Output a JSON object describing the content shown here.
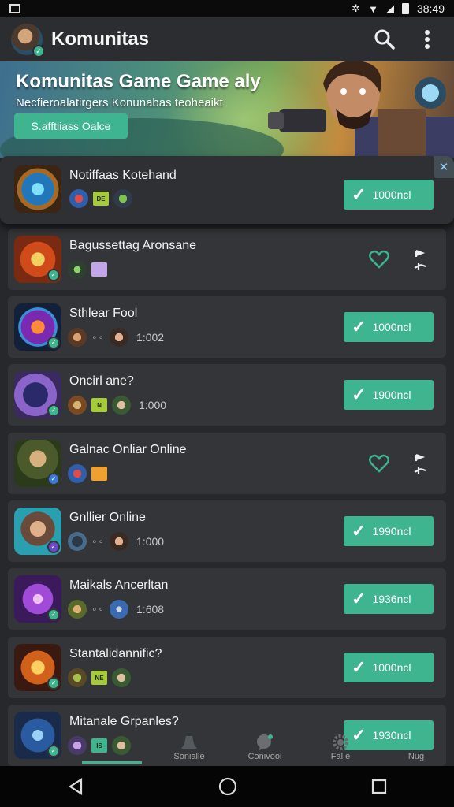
{
  "status_bar": {
    "time": "38:49"
  },
  "app_bar": {
    "title": "Komunitas"
  },
  "hero": {
    "title": "Komunitas Game Game aly",
    "subtitle": "Necfieroalatirgers Konunabas teoheaikt",
    "button_label": "S.afftiiass Oalce"
  },
  "notification": {
    "title": "Notiffaas Kotehand",
    "tag": "DE",
    "action_label": "1000ncl"
  },
  "games": [
    {
      "title": "Bagussettag Aronsane",
      "tag": "",
      "count": "",
      "action": "favorite",
      "action_label": ""
    },
    {
      "title": "Sthlear Fool",
      "tag": "",
      "count": "1:002",
      "action": "join",
      "action_label": "1000ncl"
    },
    {
      "title": "Oncirl ane?",
      "tag": "N",
      "count": "1:000",
      "action": "join",
      "action_label": "1900ncl"
    },
    {
      "title": "Galnac Onliar Online",
      "tag": "",
      "count": "",
      "action": "favorite",
      "action_label": ""
    },
    {
      "title": "Gnllier Online",
      "tag": "",
      "count": "1:000",
      "action": "join",
      "action_label": "1990ncl"
    },
    {
      "title": "Maikals Ancerltan",
      "tag": "",
      "count": "1:608",
      "action": "join",
      "action_label": "1936ncl"
    },
    {
      "title": "Stantalidannific?",
      "tag": "NE",
      "count": "",
      "action": "join",
      "action_label": "1000ncl"
    },
    {
      "title": "Mitanale Grpanles?",
      "tag": "IS",
      "count": "",
      "action": "join",
      "action_label": "1930ncl"
    }
  ],
  "bottom_tabs": [
    {
      "label": "",
      "icon": "home-icon"
    },
    {
      "label": "",
      "icon": "list-icon"
    },
    {
      "label": "Sonialle",
      "icon": "hat-icon"
    },
    {
      "label": "Conivool",
      "icon": "chat-icon"
    },
    {
      "label": "Fal.e",
      "icon": "gear-icon"
    },
    {
      "label": "Nug",
      "icon": "more-icon"
    }
  ],
  "colors": {
    "accent": "#3fb58f",
    "background": "#26282b",
    "card": "#333538",
    "link": "#8fd0f7"
  }
}
